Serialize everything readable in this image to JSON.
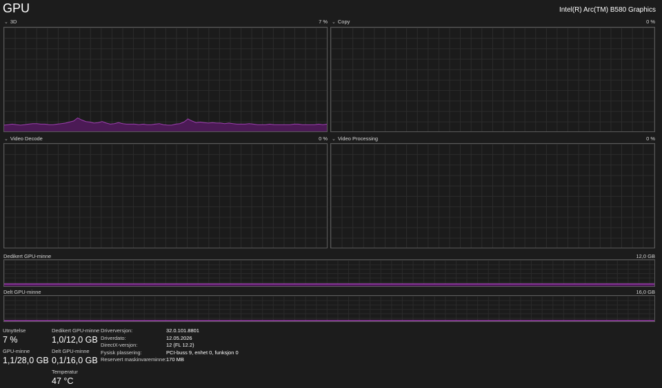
{
  "header": {
    "title": "GPU",
    "gpu_name": "Intel(R) Arc(TM) B580 Graphics"
  },
  "colors": {
    "accent": "#9c3fae",
    "fill": "#4b1a55",
    "grid": "#2c2c2c",
    "border": "#5a5a5a",
    "background": "#1c1c1c"
  },
  "engines": [
    {
      "name": "3D",
      "percent": "7 %",
      "icon": "chevron-down-icon",
      "history": [
        6,
        6.5,
        7,
        6.5,
        6,
        6.5,
        7,
        7.5,
        7.5,
        7,
        7,
        6.5,
        6.5,
        7,
        7.5,
        8,
        9,
        10,
        13,
        11,
        9.5,
        9,
        8,
        8.5,
        9.5,
        8,
        7,
        7.5,
        8.5,
        7.5,
        7,
        7,
        7,
        6.5,
        7,
        6.5,
        6.5,
        7,
        7.5,
        6.5,
        6,
        6,
        7,
        7.5,
        9,
        12,
        10,
        8.5,
        9,
        8.5,
        8,
        8.5,
        8,
        8,
        7.5,
        8,
        7.5,
        7,
        7,
        7,
        7.5,
        7,
        6.5,
        6.5,
        6.5,
        7,
        6.5,
        6.5,
        6.5,
        6.5,
        6.5,
        7,
        7,
        6.5,
        6.5,
        6.5,
        6.5,
        7,
        6.5,
        7
      ]
    },
    {
      "name": "Copy",
      "percent": "0 %",
      "icon": "chevron-down-icon",
      "history": []
    },
    {
      "name": "Video Decode",
      "percent": "0 %",
      "icon": "chevron-down-icon",
      "history": []
    },
    {
      "name": "Video Processing",
      "percent": "0 %",
      "icon": "chevron-down-icon",
      "history": []
    }
  ],
  "memory_graphs": [
    {
      "name": "Dedikert GPU-minne",
      "max": "12,0 GB",
      "used_fraction": 0.083
    },
    {
      "name": "Delt GPU-minne",
      "max": "16,0 GB",
      "used_fraction": 0.006
    }
  ],
  "stats": {
    "utilization": {
      "label": "Utnyttelse",
      "value": "7 %"
    },
    "gpu_memory": {
      "label": "GPU-minne",
      "value": "1,1/28,0 GB"
    },
    "dedicated_memory": {
      "label": "Dedikert GPU-minne",
      "value": "1,0/12,0 GB"
    },
    "shared_memory": {
      "label": "Delt GPU-minne",
      "value": "0,1/16,0 GB"
    },
    "temperature": {
      "label": "Temperatur",
      "value": "47 °C"
    }
  },
  "info": [
    {
      "key": "Driverversjon:",
      "value": "32.0.101.8801"
    },
    {
      "key": "Driverdato:",
      "value": "12.05.2026"
    },
    {
      "key": "DirectX-versjon:",
      "value": "12 (FL 12.2)"
    },
    {
      "key": "Fysisk plassering:",
      "value": "PCI-buss 9, enhet 0, funksjon 0"
    },
    {
      "key": "Reservert maskinvareminne:",
      "value": "170 MB"
    }
  ]
}
